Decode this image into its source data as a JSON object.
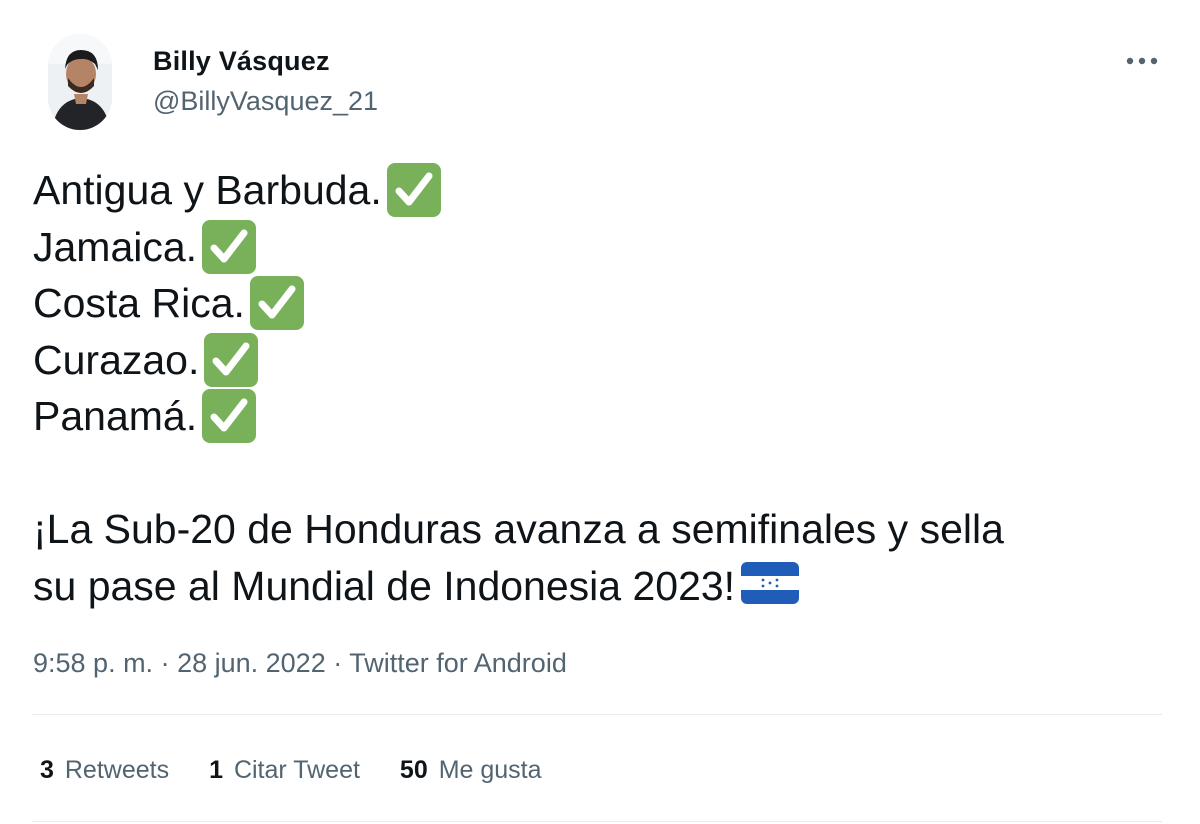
{
  "author": {
    "display_name": "Billy Vásquez",
    "handle": "@BillyVasquez_21"
  },
  "tweet": {
    "lines": [
      "Antigua y Barbuda.",
      "Jamaica.",
      "Costa Rica.",
      "Curazao.",
      "Panamá."
    ],
    "line_icon": "check-mark-button-emoji",
    "paragraph_line1": "¡La Sub-20 de Honduras avanza a semifinales y sella",
    "paragraph_line2": "su pase al Mundial de Indonesia 2023!",
    "paragraph_icon": "honduras-flag-emoji"
  },
  "meta": {
    "time": "9:58 p. m.",
    "separator": " · ",
    "date": "28 jun. 2022",
    "source": "Twitter for Android"
  },
  "stats": {
    "retweets_count": "3",
    "retweets_label": "Retweets",
    "quotes_count": "1",
    "quotes_label": "Citar Tweet",
    "likes_count": "50",
    "likes_label": "Me gusta"
  },
  "icons": {
    "more": "more-options-icon"
  },
  "colors": {
    "text_primary": "#0f1419",
    "text_secondary": "#536471",
    "check_green": "#78b159",
    "flag_blue": "#1f5db8",
    "divider": "#e6ecf0"
  }
}
